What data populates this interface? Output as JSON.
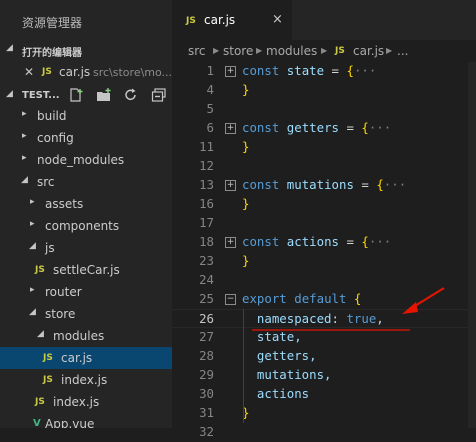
{
  "sidebar": {
    "title": "资源管理器",
    "open_editors": {
      "header": "打开的编辑器",
      "file": {
        "name": "car.js",
        "path": "src\\store\\mo...",
        "icon": "JS"
      }
    },
    "workspace": {
      "header": "TEST..."
    },
    "toolbar": {
      "icons": [
        "new-file-icon",
        "new-folder-icon",
        "refresh-icon",
        "collapse-all-icon"
      ]
    },
    "tree": [
      {
        "label": "build"
      },
      {
        "label": "config"
      },
      {
        "label": "node_modules"
      },
      {
        "label": "src"
      },
      {
        "label": "assets"
      },
      {
        "label": "components"
      },
      {
        "label": "js"
      },
      {
        "label": "settleCar.js",
        "icon": "JS"
      },
      {
        "label": "router"
      },
      {
        "label": "store"
      },
      {
        "label": "modules"
      },
      {
        "label": "car.js",
        "icon": "JS"
      },
      {
        "label": "index.js",
        "icon": "JS"
      },
      {
        "label": "index.js",
        "icon": "JS"
      },
      {
        "label": "App.vue",
        "icon": "V"
      }
    ]
  },
  "tab": {
    "label": "car.js",
    "icon": "JS",
    "close": "×"
  },
  "breadcrumb": [
    "src",
    "store",
    "modules",
    "car.js",
    "..."
  ],
  "editor": {
    "line_numbers": [
      "1",
      "4",
      "5",
      "6",
      "11",
      "12",
      "13",
      "16",
      "17",
      "18",
      "23",
      "24",
      "25",
      "26",
      "27",
      "28",
      "29",
      "30",
      "31",
      "32"
    ],
    "current_line": "26",
    "code": {
      "const_kw": "const",
      "state": "state",
      "getters": "getters",
      "mutations": "mutations",
      "actions": "actions",
      "assign": " = ",
      "open": "{",
      "ellipsis": "···",
      "close": "}",
      "export": "export",
      "default": "default",
      "namespaced": "namespaced",
      "colon": ": ",
      "true_kw": "true",
      "comma": ",",
      "state_item": "state,",
      "getters_item": "getters,",
      "mutations_item": "mutations,",
      "actions_item": "actions"
    }
  },
  "colors": {
    "annotation": "#e51400",
    "selection": "#094771",
    "keyword": "#569cd6",
    "property": "#9cdcfe",
    "bracket": "#ffd700"
  }
}
